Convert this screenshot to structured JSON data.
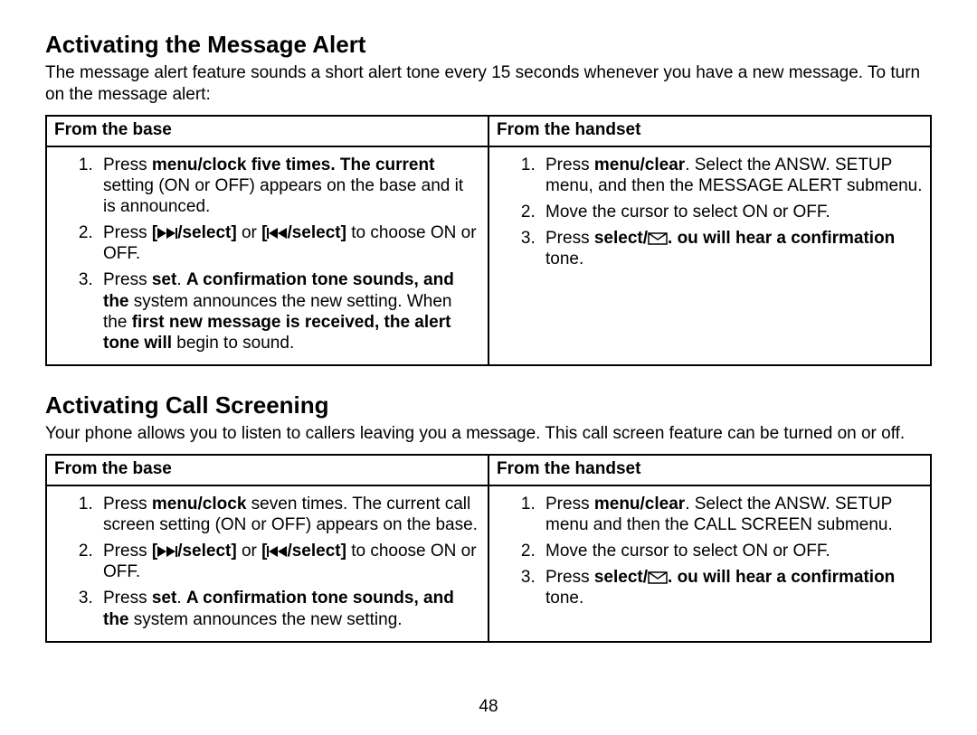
{
  "page_number": "48",
  "sections": [
    {
      "heading": "Activating the Message Alert",
      "intro": "The message alert feature sounds a short alert tone every 15 seconds whenever you have a new message. To turn on the message alert:",
      "col_headers": [
        "From the base",
        "From the handset"
      ],
      "base_steps": [
        {
          "prefix": "Press ",
          "bold1": "menu/clock",
          "mid1": " ",
          "bold2": "five times. The current",
          "rest": " setting (ON or OFF) appears on the base and it is announced."
        },
        {
          "prefix": "Press ",
          "bold1": "[",
          "icon1": "fwd",
          "bold1b": "/select]",
          "mid": " or ",
          "bold2": "[",
          "icon2": "rew",
          "bold2b": "/select]",
          "rest": "  to choose ON or OFF."
        },
        {
          "prefix": "Press ",
          "bold1": "set",
          "mid1": ". ",
          "bold2": "A confirmation tone sounds, and the",
          "rest": " system announces the new setting. When the ",
          "bold3": "first new message is received, the alert tone will",
          "rest2": " begin to sound."
        }
      ],
      "handset_steps": [
        {
          "prefix": "Press ",
          "bold1": "menu/clear",
          "rest": ". Select the ANSW. SETUP menu, and then the MESSAGE ALERT submenu."
        },
        {
          "rest": "Move the cursor to select ON or OFF."
        },
        {
          "prefix": "Press ",
          "bold1": "select/",
          "icon": "mail",
          "bold1b": ".",
          "gap": "    ",
          "bold2": "ou will hear a confirmation",
          "rest": " tone."
        }
      ]
    },
    {
      "heading": "Activating Call Screening",
      "intro": "Your phone allows you to listen to callers leaving you a message. This call screen feature can be turned on or off.",
      "col_headers": [
        "From the base",
        "From the handset"
      ],
      "base_steps": [
        {
          "prefix": "Press ",
          "bold1": "menu/clock",
          "rest": " seven times. The current call screen setting (ON or OFF) appears on the base."
        },
        {
          "prefix": "Press ",
          "bold1": "[",
          "icon1": "fwd",
          "bold1b": "/select]",
          "mid": " or ",
          "bold2": "[",
          "icon2": "rew",
          "bold2b": "/select]",
          "rest": "  to choose ON or OFF."
        },
        {
          "prefix": "Press ",
          "bold1": "set",
          "mid1": ". ",
          "bold2": "A confirmation tone sounds, and the",
          "rest": " system announces the new setting."
        }
      ],
      "handset_steps": [
        {
          "prefix": "Press ",
          "bold1": "menu/clear",
          "rest": ". Select the ANSW. SETUP menu and then the CALL SCREEN submenu."
        },
        {
          "rest": "Move the cursor to select ON or OFF."
        },
        {
          "prefix": "Press ",
          "bold1": "select/",
          "icon": "mail",
          "bold1b": ".",
          "gap": "    ",
          "bold2": "ou will hear a confirmation",
          "rest": " tone."
        }
      ]
    }
  ]
}
